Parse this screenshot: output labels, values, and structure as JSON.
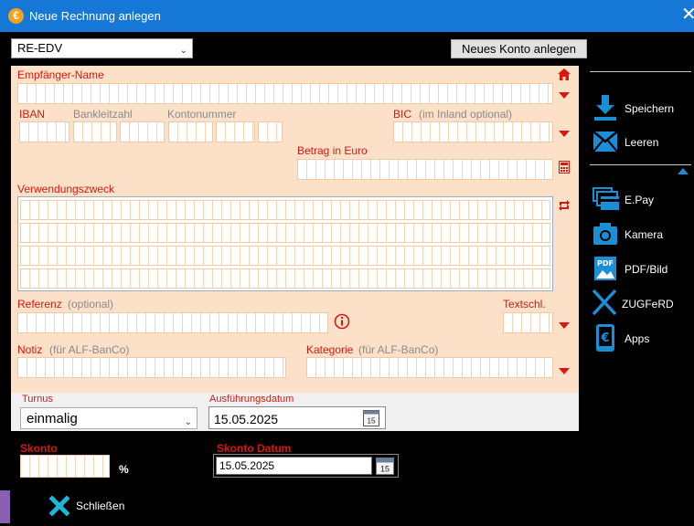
{
  "window": {
    "title": "Neue Rechnung anlegen"
  },
  "account": {
    "selected": "RE-EDV",
    "new_account_label": "Neues Konto anlegen"
  },
  "form": {
    "recipient_label": "Empfänger-Name",
    "iban_label": "IBAN",
    "bankleitzahl_label": "Bankleitzahl",
    "kontonummer_label": "Kontonummer",
    "bic_label": "BIC",
    "bic_hint": "(im Inland optional)",
    "amount_label": "Betrag in Euro",
    "purpose_label": "Verwendungszweck",
    "reference_label": "Referenz",
    "reference_hint": "(optional)",
    "textkey_label": "Textschl.",
    "note_label": "Notiz",
    "note_hint": "(für ALF-BanCo)",
    "category_label": "Kategorie",
    "category_hint": "(für ALF-BanCo)",
    "turnus_label": "Turnus",
    "turnus_value": "einmalig",
    "execution_label": "Ausführungsdatum",
    "execution_value": "15.05.2025",
    "skonto_label": "Skonto",
    "skonto_unit": "%",
    "skonto_date_label": "Skonto Datum",
    "skonto_date_value": "15.05.2025",
    "calendar_day": "15"
  },
  "sidebar": {
    "save_label": "Speichern",
    "clear_label": "Leeren",
    "epay_label": "E.Pay",
    "camera_label": "Kamera",
    "pdf_label": "PDF/Bild",
    "pdf_icon_text": "PDF",
    "zugferd_label": "ZUGFeRD",
    "apps_label": "Apps"
  },
  "footer": {
    "close_label": "Schließen"
  },
  "colors": {
    "titlebar": "#1577d6",
    "panel": "#fde0c8",
    "accent_red": "#d8180f",
    "accent_blue": "#1b8fd6"
  }
}
